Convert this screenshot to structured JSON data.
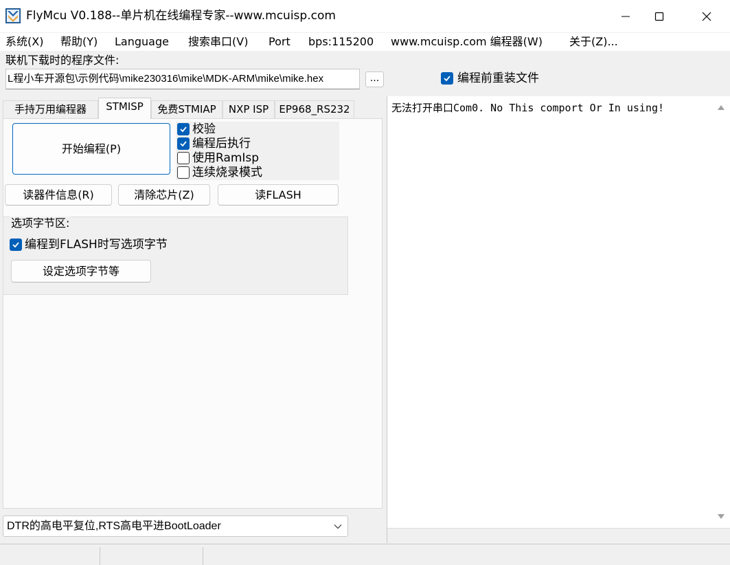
{
  "window": {
    "title": "FlyMcu V0.188--单片机在线编程专家--www.mcuisp.com"
  },
  "menu": {
    "items": [
      "系统(X)",
      "帮助(Y)",
      "Language",
      "搜索串口(V)",
      "Port",
      "bps:115200",
      "www.mcuisp.com 编程器(W)",
      "关于(Z)..."
    ]
  },
  "file": {
    "label": "联机下载时的程序文件:",
    "path": "L程小车开源包\\示例代码\\mike230316\\mike\\MDK-ARM\\mike\\mike.hex",
    "browse_label": "...",
    "reload_label": "编程前重装文件",
    "reload_checked": true
  },
  "tabs": {
    "items": [
      "手持万用编程器",
      "STMISP",
      "免费STMIAP",
      "NXP ISP",
      "EP968_RS232"
    ],
    "active": "STMISP"
  },
  "actions": {
    "start": "开始编程(P)",
    "read_info": "读器件信息(R)",
    "erase": "清除芯片(Z)",
    "read_flash": "读FLASH"
  },
  "options": [
    {
      "label": "校验",
      "checked": true
    },
    {
      "label": "编程后执行",
      "checked": true
    },
    {
      "label": "使用RamIsp",
      "checked": false
    },
    {
      "label": "连续烧录模式",
      "checked": false
    }
  ],
  "option_bytes": {
    "title": "选项字节区:",
    "write_label": "编程到FLASH时写选项字节",
    "write_checked": true,
    "set_button": "设定选项字节等"
  },
  "reset_mode": {
    "selected": "DTR的高电平复位,RTS高电平进BootLoader"
  },
  "output": {
    "text": "无法打开串口Com0. No This comport Or In using!"
  },
  "colors": {
    "accent": "#005fb8",
    "window_bg": "#f0f0f0"
  },
  "icons": {
    "app": "flymcu-logo-icon",
    "minimize": "minimize-icon",
    "maximize": "maximize-icon",
    "close": "close-icon"
  }
}
